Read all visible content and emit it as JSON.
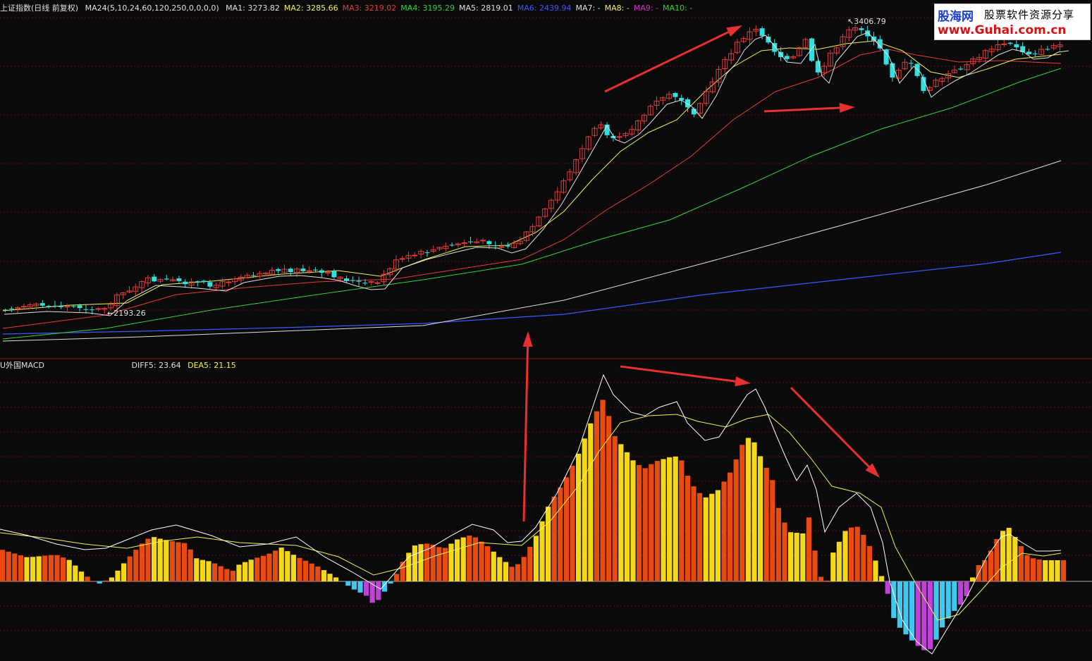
{
  "header": {
    "index_title": "上证指数(日线 前复权)",
    "ma_setting": "MA24(5,10,24,60,120,250,0,0,0,0)",
    "ma_values": [
      {
        "label": "MA1: 3273.82",
        "color": "#e0e0e0"
      },
      {
        "label": "MA2: 3285.66",
        "color": "#f2f254"
      },
      {
        "label": "MA3: 3219.02",
        "color": "#e43b3b"
      },
      {
        "label": "MA4: 3195.29",
        "color": "#33d433"
      },
      {
        "label": "MA5: 2819.01",
        "color": "#e0e0e0"
      },
      {
        "label": "MA6: 2439.94",
        "color": "#3b58ff"
      },
      {
        "label": "MA7: -",
        "color": "#e0e0e0"
      },
      {
        "label": "MA8: -",
        "color": "#f2f254"
      },
      {
        "label": "MA9: -",
        "color": "#d62bd6"
      },
      {
        "label": "MA10: -",
        "color": "#33d433"
      }
    ]
  },
  "indicator": {
    "name": "U外国MACD",
    "diff_label": "DIFF5: 23.64",
    "dea_label": "DEA5: 21.15"
  },
  "watermark": {
    "brand": "股海网",
    "slogan": "股票软件资源分享",
    "url": "www.Guhai.com.cn"
  },
  "chart_data": [
    {
      "type": "candlestick",
      "title": "上证指数(日线 前复权)",
      "annotations": [
        {
          "text": "2193.26",
          "label": "low"
        },
        {
          "text": "3406.79",
          "label": "high"
        }
      ],
      "colors": {
        "up": "#e43b3b",
        "down": "#33e0e0",
        "ma1": "#e0e0e0",
        "ma2": "#f2f254",
        "ma3": "#e43b3b",
        "ma4": "#33d433",
        "ma5": "#e0e0e0",
        "ma6": "#3b58ff",
        "grid": "#6b1010",
        "arrow": "#e83030"
      }
    },
    {
      "type": "bar",
      "title": "U外国MACD",
      "series": [
        {
          "name": "DIFF5",
          "last": 23.64
        },
        {
          "name": "DEA5",
          "last": 21.15
        }
      ],
      "colors": {
        "pos_a": "#e84a10",
        "pos_b": "#f5d818",
        "neg_a": "#40c8f0",
        "neg_b": "#c040d8",
        "diff": "#ffffff",
        "dea": "#f2f254"
      }
    }
  ]
}
